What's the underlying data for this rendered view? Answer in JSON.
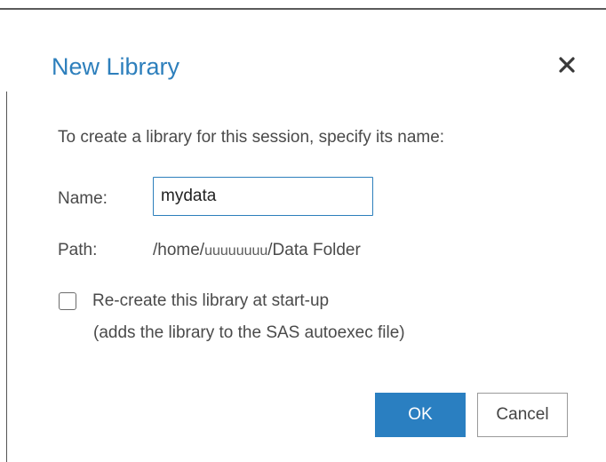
{
  "dialog": {
    "title": "New Library",
    "close_icon": "close-icon",
    "instruction": "To create a library for this session, specify its name:",
    "name": {
      "label": "Name:",
      "value": "mydata"
    },
    "path": {
      "label": "Path:",
      "prefix": "/home/",
      "user": "uuuuuuuu",
      "suffix": "/Data Folder"
    },
    "recreate": {
      "checked": false,
      "label": "Re-create this library at start-up",
      "sublabel": "(adds the library to the SAS autoexec file)"
    },
    "buttons": {
      "ok": "OK",
      "cancel": "Cancel"
    }
  },
  "colors": {
    "accent": "#2d7fbc",
    "text": "#4a4a4a",
    "primary_button": "#2a7fc1"
  }
}
